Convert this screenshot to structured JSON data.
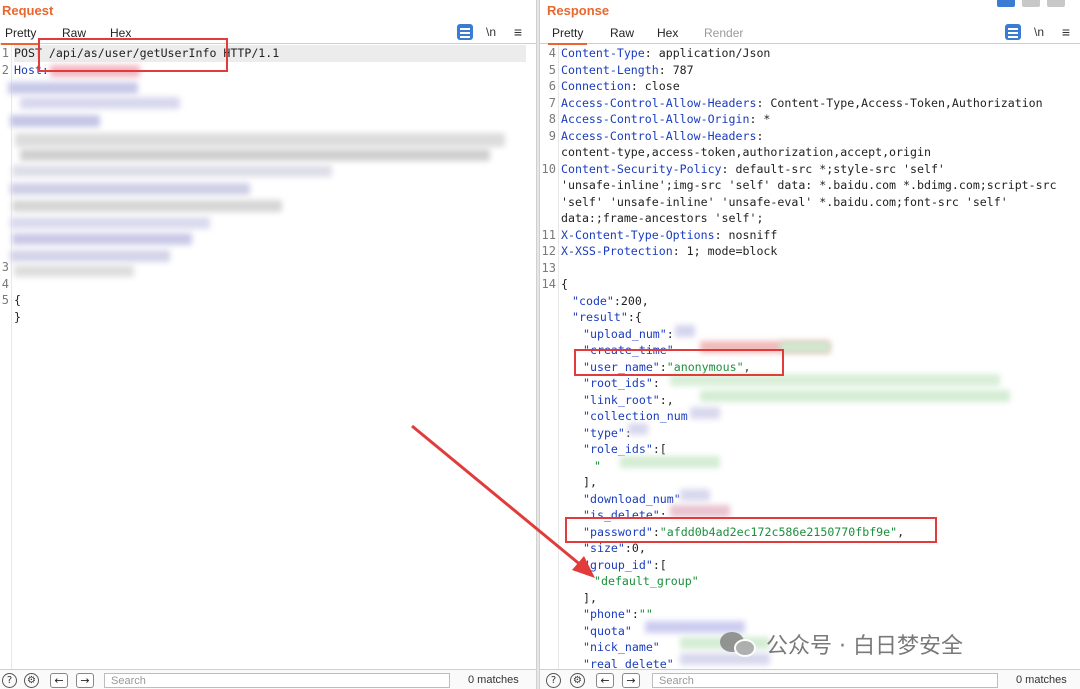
{
  "request": {
    "title": "Request",
    "tabs": [
      "Pretty",
      "Raw",
      "Hex"
    ],
    "active_tab": "Pretty",
    "newline_toggle": "\\n",
    "menu_icon": "≡",
    "lines": [
      {
        "num": "1",
        "text": "POST /api/as/user/getUserInfo HTTP/1.1"
      },
      {
        "num": "2",
        "text": "Host:"
      },
      {
        "num": "3",
        "text": ""
      },
      {
        "num": "4",
        "text": ""
      },
      {
        "num": "5",
        "text": "{"
      },
      {
        "num": "",
        "text": "}"
      }
    ],
    "search_placeholder": "Search",
    "matches": "0 matches"
  },
  "response": {
    "title": "Response",
    "tabs": [
      "Pretty",
      "Raw",
      "Hex",
      "Render"
    ],
    "active_tab": "Pretty",
    "newline_toggle": "\\n",
    "menu_icon": "≡",
    "headers": [
      {
        "num": "4",
        "key": "Content-Type",
        "value": " application/Json"
      },
      {
        "num": "5",
        "key": "Content-Length",
        "value": " 787"
      },
      {
        "num": "6",
        "key": "Connection",
        "value": " close"
      },
      {
        "num": "7",
        "key": "Access-Control-Allow-Headers",
        "value": " Content-Type,Access-Token,Authorization"
      },
      {
        "num": "8",
        "key": "Access-Control-Allow-Origin",
        "value": " *"
      },
      {
        "num": "9",
        "key": "Access-Control-Allow-Headers",
        "value": ""
      },
      {
        "num": "",
        "key": "",
        "value": "content-type,access-token,authorization,accept,origin"
      },
      {
        "num": "10",
        "key": "Content-Security-Policy",
        "value": " default-src *;style-src 'self'"
      },
      {
        "num": "",
        "key": "",
        "value": "'unsafe-inline';img-src 'self' data: *.baidu.com *.bdimg.com;script-src"
      },
      {
        "num": "",
        "key": "",
        "value": "'self' 'unsafe-inline' 'unsafe-eval' *.baidu.com;font-src 'self'"
      },
      {
        "num": "",
        "key": "",
        "value": "data:;frame-ancestors 'self';"
      },
      {
        "num": "11",
        "key": "X-Content-Type-Options",
        "value": " nosniff"
      },
      {
        "num": "12",
        "key": "X-XSS-Protection",
        "value": " 1; mode=block"
      },
      {
        "num": "13",
        "key": "",
        "value": ""
      }
    ],
    "body": [
      {
        "num": "14",
        "indent": 0,
        "k": "",
        "rest": "{"
      },
      {
        "num": "",
        "indent": 1,
        "k": "\"code\"",
        "rest": ":200,"
      },
      {
        "num": "",
        "indent": 1,
        "k": "\"result\"",
        "rest": ":{"
      },
      {
        "num": "",
        "indent": 2,
        "k": "\"upload_num\"",
        "rest": ":"
      },
      {
        "num": "",
        "indent": 2,
        "k": "\"create_time\"",
        "rest": ""
      },
      {
        "num": "",
        "indent": 2,
        "k": "\"user_name\"",
        "rest": ":",
        "s": "\"anonymous\"",
        "tail": ","
      },
      {
        "num": "",
        "indent": 2,
        "k": "\"root_ids\"",
        "rest": ":"
      },
      {
        "num": "",
        "indent": 2,
        "k": "\"link_root\"",
        "rest": ":",
        "tail": ","
      },
      {
        "num": "",
        "indent": 2,
        "k": "\"collection_num",
        "rest": ""
      },
      {
        "num": "",
        "indent": 2,
        "k": "\"type\"",
        "rest": ":"
      },
      {
        "num": "",
        "indent": 2,
        "k": "\"role_ids\"",
        "rest": ":["
      },
      {
        "num": "",
        "indent": 3,
        "k": "",
        "rest": "",
        "s": "\"",
        "tail": ""
      },
      {
        "num": "",
        "indent": 2,
        "k": "",
        "rest": "],"
      },
      {
        "num": "",
        "indent": 2,
        "k": "\"download_num\"",
        "rest": ""
      },
      {
        "num": "",
        "indent": 2,
        "k": "\"is_delete\"",
        "rest": ":"
      },
      {
        "num": "",
        "indent": 2,
        "k": "\"password\"",
        "rest": ":",
        "s": "\"afdd0b4ad2ec172c586e2150770fbf9e\"",
        "tail": ","
      },
      {
        "num": "",
        "indent": 2,
        "k": "\"size\"",
        "rest": ":0,"
      },
      {
        "num": "",
        "indent": 2,
        "k": "\"group_id\"",
        "rest": ":["
      },
      {
        "num": "",
        "indent": 3,
        "k": "",
        "rest": "",
        "s": "\"default_group\"",
        "tail": ""
      },
      {
        "num": "",
        "indent": 2,
        "k": "",
        "rest": "],"
      },
      {
        "num": "",
        "indent": 2,
        "k": "\"phone\"",
        "rest": ":",
        "s": "\"\"",
        "tail": ""
      },
      {
        "num": "",
        "indent": 2,
        "k": "\"quota\"",
        "rest": ""
      },
      {
        "num": "",
        "indent": 2,
        "k": "\"nick_name\"",
        "rest": ""
      },
      {
        "num": "",
        "indent": 2,
        "k": "\"real_delete\"",
        "rest": ""
      }
    ],
    "search_placeholder": "Search",
    "matches": "0 matches"
  },
  "watermark": {
    "text": "公众号 · 白日梦安全"
  },
  "colors": {
    "accent": "#e8672e",
    "header_key": "#1a3cbf",
    "string": "#1b8f3c",
    "annotation_red": "#e23b3b",
    "wrap_button": "#3b7bd4"
  }
}
